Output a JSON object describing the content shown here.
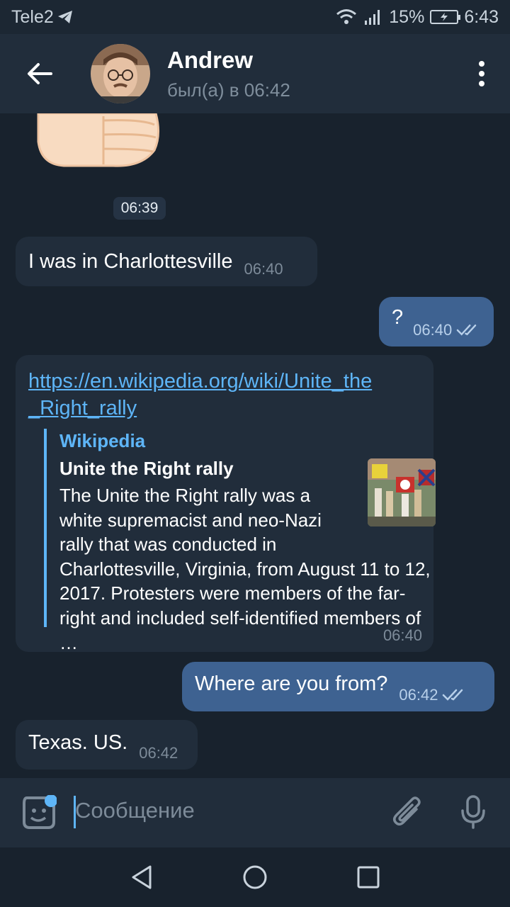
{
  "status_bar": {
    "carrier": "Tele2",
    "battery": "15%",
    "time": "6:43"
  },
  "header": {
    "name": "Andrew",
    "last_seen": "был(а) в 06:42"
  },
  "sticker": {
    "description": "thumb-up",
    "time": "06:39"
  },
  "messages": [
    {
      "direction": "in",
      "text": "I was in Charlottesville",
      "time": "06:40"
    },
    {
      "direction": "out",
      "text": "?",
      "time": "06:40"
    },
    {
      "direction": "in",
      "link": "https://en.wikipedia.org/wiki/Unite_the_Right_rally",
      "link_line1": "https://en.wikipedia.org/wiki/Unite_the",
      "link_line2": "_Right_rally",
      "preview": {
        "site": "Wikipedia",
        "title": "Unite the Right rally",
        "description": "The Unite the Right rally was a white supremacist and neo-Nazi rally that was conducted in Charlottesville, Virginia, from August 11 to 12, 2017. Protesters were members of the far-right and included self-identified members of …"
      },
      "time": "06:40"
    },
    {
      "direction": "out",
      "text": "Where are you from?",
      "time": "06:42"
    },
    {
      "direction": "in",
      "text": "Texas. US.",
      "time": "06:42"
    }
  ],
  "composer": {
    "placeholder": "Сообщение"
  },
  "icons": {
    "back": "arrow-left-icon",
    "menu": "more-vertical-icon",
    "emoji": "sticker-icon",
    "attach": "paperclip-icon",
    "mic": "microphone-icon",
    "nav_back": "triangle-back-icon",
    "nav_home": "circle-home-icon",
    "nav_recent": "square-recent-icon"
  },
  "colors": {
    "background": "#18222d",
    "header": "#212d3b",
    "incoming": "#212d3b",
    "outgoing": "#3e6291",
    "accent": "#5eb5f7"
  }
}
